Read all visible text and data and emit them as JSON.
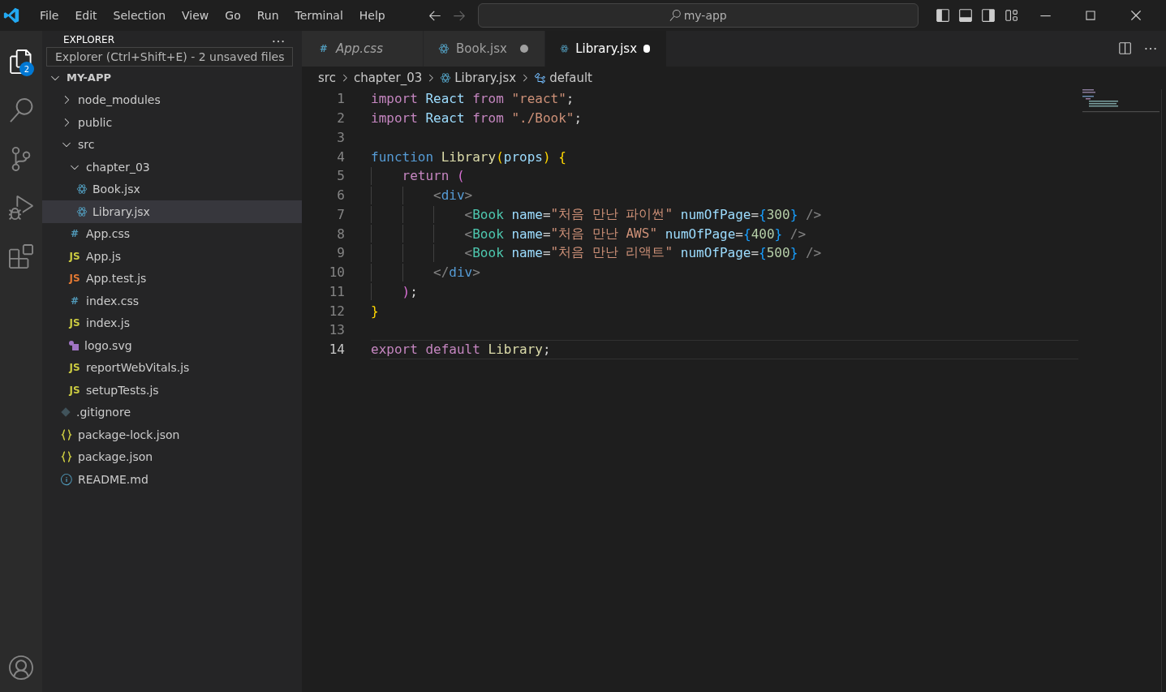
{
  "menu": [
    "File",
    "Edit",
    "Selection",
    "View",
    "Go",
    "Run",
    "Terminal",
    "Help"
  ],
  "command_center": {
    "text": "my-app"
  },
  "activity_bar": {
    "items": [
      {
        "kind": "files",
        "selected": true,
        "badge": "2"
      },
      {
        "kind": "search",
        "selected": false
      },
      {
        "kind": "source-control",
        "selected": false
      },
      {
        "kind": "run-debug",
        "selected": false
      },
      {
        "kind": "extensions",
        "selected": false
      }
    ],
    "account": {
      "kind": "account"
    }
  },
  "tooltip": {
    "text": "Explorer (Ctrl+Shift+E) - 2 unsaved files"
  },
  "sidebar": {
    "title": "EXPLORER",
    "root": {
      "label": "MY-APP",
      "expanded": true
    },
    "tree": [
      {
        "label": "node_modules",
        "kind": "folder",
        "expanded": false,
        "selected": false
      },
      {
        "label": "public",
        "kind": "folder",
        "expanded": false,
        "selected": false
      },
      {
        "label": "src",
        "kind": "folder",
        "expanded": true,
        "selected": false,
        "children": [
          {
            "label": "chapter_03",
            "kind": "folder",
            "expanded": true,
            "selected": false,
            "children": [
              {
                "label": "Book.jsx",
                "kind": "react",
                "selected": false
              },
              {
                "label": "Library.jsx",
                "kind": "react",
                "selected": true
              }
            ]
          },
          {
            "label": "App.css",
            "kind": "css",
            "badge": "#",
            "selected": false
          },
          {
            "label": "App.js",
            "kind": "js",
            "badge": "JS",
            "selected": false
          },
          {
            "label": "App.test.js",
            "kind": "test",
            "badge": "JS",
            "selected": false
          },
          {
            "label": "index.css",
            "kind": "css",
            "badge": "#",
            "selected": false
          },
          {
            "label": "index.js",
            "kind": "js",
            "badge": "JS",
            "selected": false
          },
          {
            "label": "logo.svg",
            "kind": "svg",
            "selected": false
          },
          {
            "label": "reportWebVitals.js",
            "kind": "js",
            "badge": "JS",
            "selected": false
          },
          {
            "label": "setupTests.js",
            "kind": "js",
            "badge": "JS",
            "selected": false
          }
        ]
      },
      {
        "label": ".gitignore",
        "kind": "git",
        "selected": false
      },
      {
        "label": "package-lock.json",
        "kind": "json",
        "selected": false
      },
      {
        "label": "package.json",
        "kind": "json",
        "selected": false
      },
      {
        "label": "README.md",
        "kind": "info",
        "selected": false
      }
    ]
  },
  "tabs": [
    {
      "label": "App.css",
      "kind": "css",
      "badge": "#",
      "preview": true,
      "modified": false,
      "selected": false
    },
    {
      "label": "Book.jsx",
      "kind": "react",
      "preview": false,
      "modified": true,
      "selected": false
    },
    {
      "label": "Library.jsx",
      "kind": "react",
      "preview": false,
      "modified": true,
      "selected": true
    }
  ],
  "breadcrumbs": [
    {
      "label": "src",
      "kind": "folder"
    },
    {
      "label": "chapter_03",
      "kind": "folder"
    },
    {
      "label": "Library.jsx",
      "kind": "react"
    },
    {
      "label": "default",
      "kind": "symbol"
    }
  ],
  "code": [
    {
      "number": "1",
      "current": false,
      "tokens": [
        {
          "text": "import ",
          "kind": "kw"
        },
        {
          "text": "React ",
          "kind": "var"
        },
        {
          "text": "from ",
          "kind": "kw"
        },
        {
          "text": "\"react\"",
          "kind": "str"
        },
        {
          "text": ";",
          "kind": "p"
        }
      ]
    },
    {
      "number": "2",
      "current": false,
      "tokens": [
        {
          "text": "import ",
          "kind": "kw"
        },
        {
          "text": "React ",
          "kind": "var"
        },
        {
          "text": "from ",
          "kind": "kw"
        },
        {
          "text": "\"./Book\"",
          "kind": "str"
        },
        {
          "text": ";",
          "kind": "p"
        }
      ]
    },
    {
      "number": "3",
      "current": false
    },
    {
      "number": "4",
      "current": false,
      "tokens": [
        {
          "text": "function ",
          "kind": "storage"
        },
        {
          "text": "Library",
          "kind": "fn"
        },
        {
          "text": "(",
          "kind": "b1"
        },
        {
          "text": "props",
          "kind": "var"
        },
        {
          "text": ") ",
          "kind": "b1"
        },
        {
          "text": "{",
          "kind": "b1"
        }
      ]
    },
    {
      "number": "5",
      "current": false,
      "tokens": [
        {
          "text": "    return ",
          "kind": "kw"
        },
        {
          "text": "(",
          "kind": "b2"
        }
      ]
    },
    {
      "number": "6",
      "current": false,
      "tokens": [
        {
          "text": "        <",
          "kind": "tp"
        },
        {
          "text": "div",
          "kind": "storage"
        },
        {
          "text": ">",
          "kind": "tp"
        }
      ]
    },
    {
      "number": "7",
      "current": false,
      "tokens": [
        {
          "text": "            <",
          "kind": "tp"
        },
        {
          "text": "Book ",
          "kind": "tag"
        },
        {
          "text": "name",
          "kind": "var"
        },
        {
          "text": "=",
          "kind": "p"
        },
        {
          "text": "\"처음 만난 파이썬\" ",
          "kind": "str"
        },
        {
          "text": "numOfPage",
          "kind": "var"
        },
        {
          "text": "=",
          "kind": "p"
        },
        {
          "text": "{",
          "kind": "b3"
        },
        {
          "text": "300",
          "kind": "num"
        },
        {
          "text": "} ",
          "kind": "b3"
        },
        {
          "text": "/>",
          "kind": "tp"
        }
      ]
    },
    {
      "number": "8",
      "current": false,
      "tokens": [
        {
          "text": "            <",
          "kind": "tp"
        },
        {
          "text": "Book ",
          "kind": "tag"
        },
        {
          "text": "name",
          "kind": "var"
        },
        {
          "text": "=",
          "kind": "p"
        },
        {
          "text": "\"처음 만난 AWS\" ",
          "kind": "str"
        },
        {
          "text": "numOfPage",
          "kind": "var"
        },
        {
          "text": "=",
          "kind": "p"
        },
        {
          "text": "{",
          "kind": "b3"
        },
        {
          "text": "400",
          "kind": "num"
        },
        {
          "text": "} ",
          "kind": "b3"
        },
        {
          "text": "/>",
          "kind": "tp"
        }
      ]
    },
    {
      "number": "9",
      "current": false,
      "tokens": [
        {
          "text": "            <",
          "kind": "tp"
        },
        {
          "text": "Book ",
          "kind": "tag"
        },
        {
          "text": "name",
          "kind": "var"
        },
        {
          "text": "=",
          "kind": "p"
        },
        {
          "text": "\"처음 만난 리액트\" ",
          "kind": "str"
        },
        {
          "text": "numOfPage",
          "kind": "var"
        },
        {
          "text": "=",
          "kind": "p"
        },
        {
          "text": "{",
          "kind": "b3"
        },
        {
          "text": "500",
          "kind": "num"
        },
        {
          "text": "} ",
          "kind": "b3"
        },
        {
          "text": "/>",
          "kind": "tp"
        }
      ]
    },
    {
      "number": "10",
      "current": false,
      "tokens": [
        {
          "text": "        </",
          "kind": "tp"
        },
        {
          "text": "div",
          "kind": "storage"
        },
        {
          "text": ">",
          "kind": "tp"
        }
      ]
    },
    {
      "number": "11",
      "current": false,
      "tokens": [
        {
          "text": "    )",
          "kind": "b2"
        },
        {
          "text": ";",
          "kind": "p"
        }
      ]
    },
    {
      "number": "12",
      "current": false,
      "tokens": [
        {
          "text": "}",
          "kind": "b1"
        }
      ]
    },
    {
      "number": "13",
      "current": false
    },
    {
      "number": "14",
      "current": true,
      "tokens": [
        {
          "text": "export ",
          "kind": "kw"
        },
        {
          "text": "default ",
          "kind": "kw"
        },
        {
          "text": "Library",
          "kind": "fn"
        },
        {
          "text": ";",
          "kind": "p"
        }
      ]
    }
  ]
}
